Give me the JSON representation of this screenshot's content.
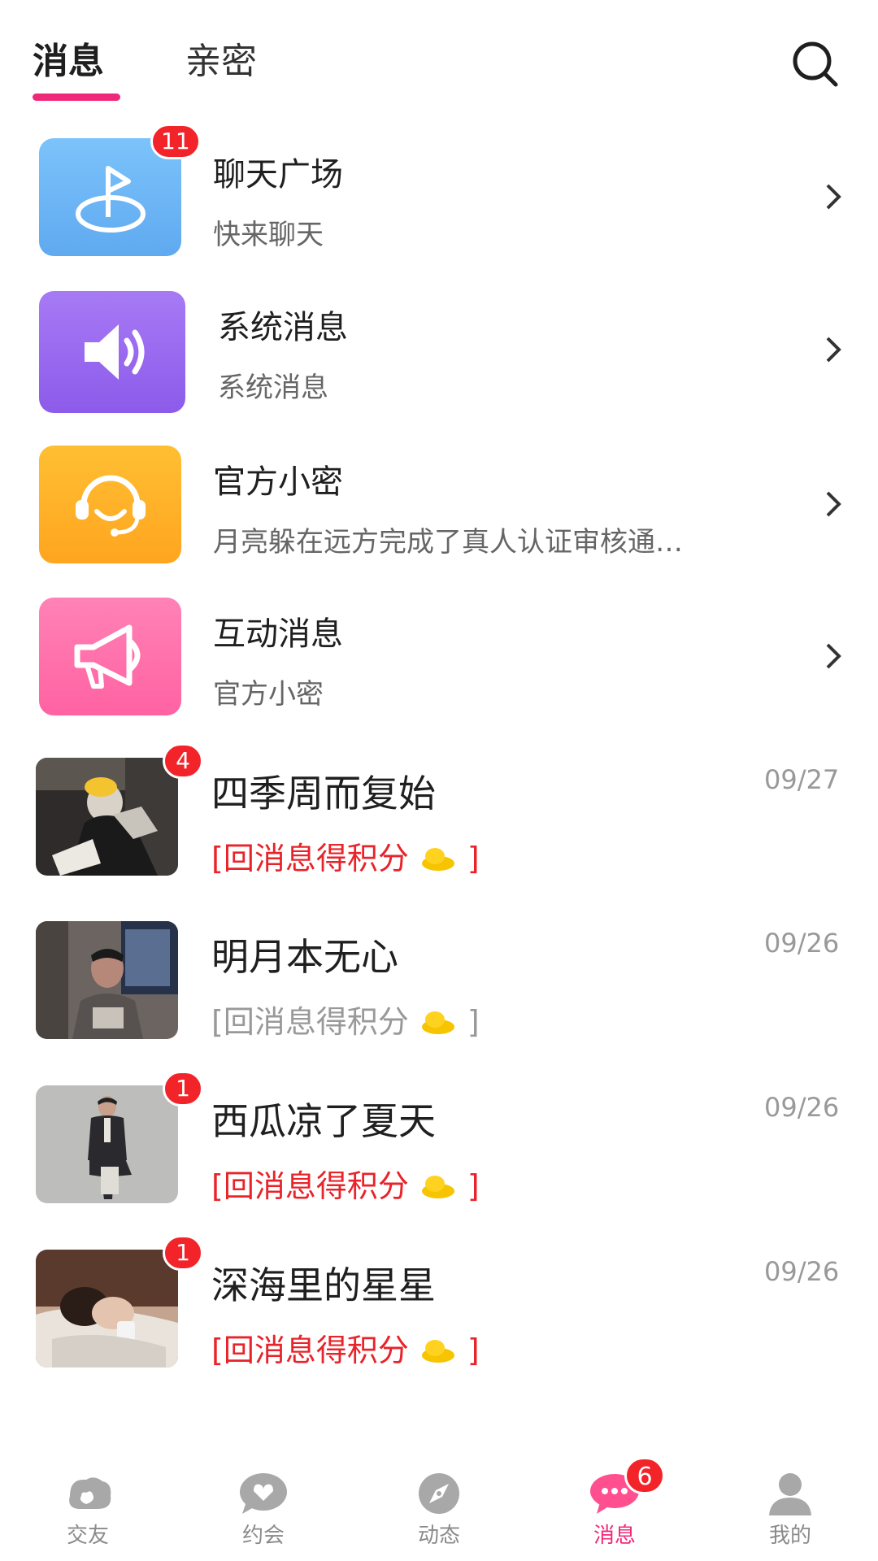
{
  "header": {
    "tabs": [
      {
        "label": "消息",
        "active": true
      },
      {
        "label": "亲密",
        "active": false
      }
    ],
    "search_icon": "search-icon",
    "accent_color": "#f0287a"
  },
  "system_items": [
    {
      "title": "聊天广场",
      "subtitle": "快来聊天",
      "badge": "11",
      "icon": "flag-icon",
      "color": "#6cb8f5"
    },
    {
      "title": "系统消息",
      "subtitle": "系统消息",
      "badge": "",
      "icon": "speaker-icon",
      "color": "#9b6cf0"
    },
    {
      "title": "官方小密",
      "subtitle": "月亮躲在远方完成了真人认证审核通…",
      "badge": "",
      "icon": "headset-icon",
      "color": "#ffb02a"
    },
    {
      "title": "互动消息",
      "subtitle": "官方小密",
      "badge": "",
      "icon": "megaphone-icon",
      "color": "#ff6fab"
    }
  ],
  "chats": [
    {
      "name": "四季周而复始",
      "date": "09/27",
      "preview_prefix": "[回消息得积分",
      "preview_suffix": "]",
      "badge": "4",
      "unread": true
    },
    {
      "name": "明月本无心",
      "date": "09/26",
      "preview_prefix": "[回消息得积分",
      "preview_suffix": "]",
      "badge": "",
      "unread": false
    },
    {
      "name": "西瓜凉了夏天",
      "date": "09/26",
      "preview_prefix": "[回消息得积分",
      "preview_suffix": "]",
      "badge": "1",
      "unread": true
    },
    {
      "name": "深海里的星星",
      "date": "09/26",
      "preview_prefix": "[回消息得积分",
      "preview_suffix": "]",
      "badge": "1",
      "unread": true
    }
  ],
  "bottom_nav": [
    {
      "label": "交友",
      "icon": "friends-icon",
      "active": false
    },
    {
      "label": "约会",
      "icon": "heart-chat-icon",
      "active": false
    },
    {
      "label": "动态",
      "icon": "compass-icon",
      "active": false
    },
    {
      "label": "消息",
      "icon": "message-icon",
      "active": true,
      "badge": "6"
    },
    {
      "label": "我的",
      "icon": "profile-icon",
      "active": false
    }
  ]
}
